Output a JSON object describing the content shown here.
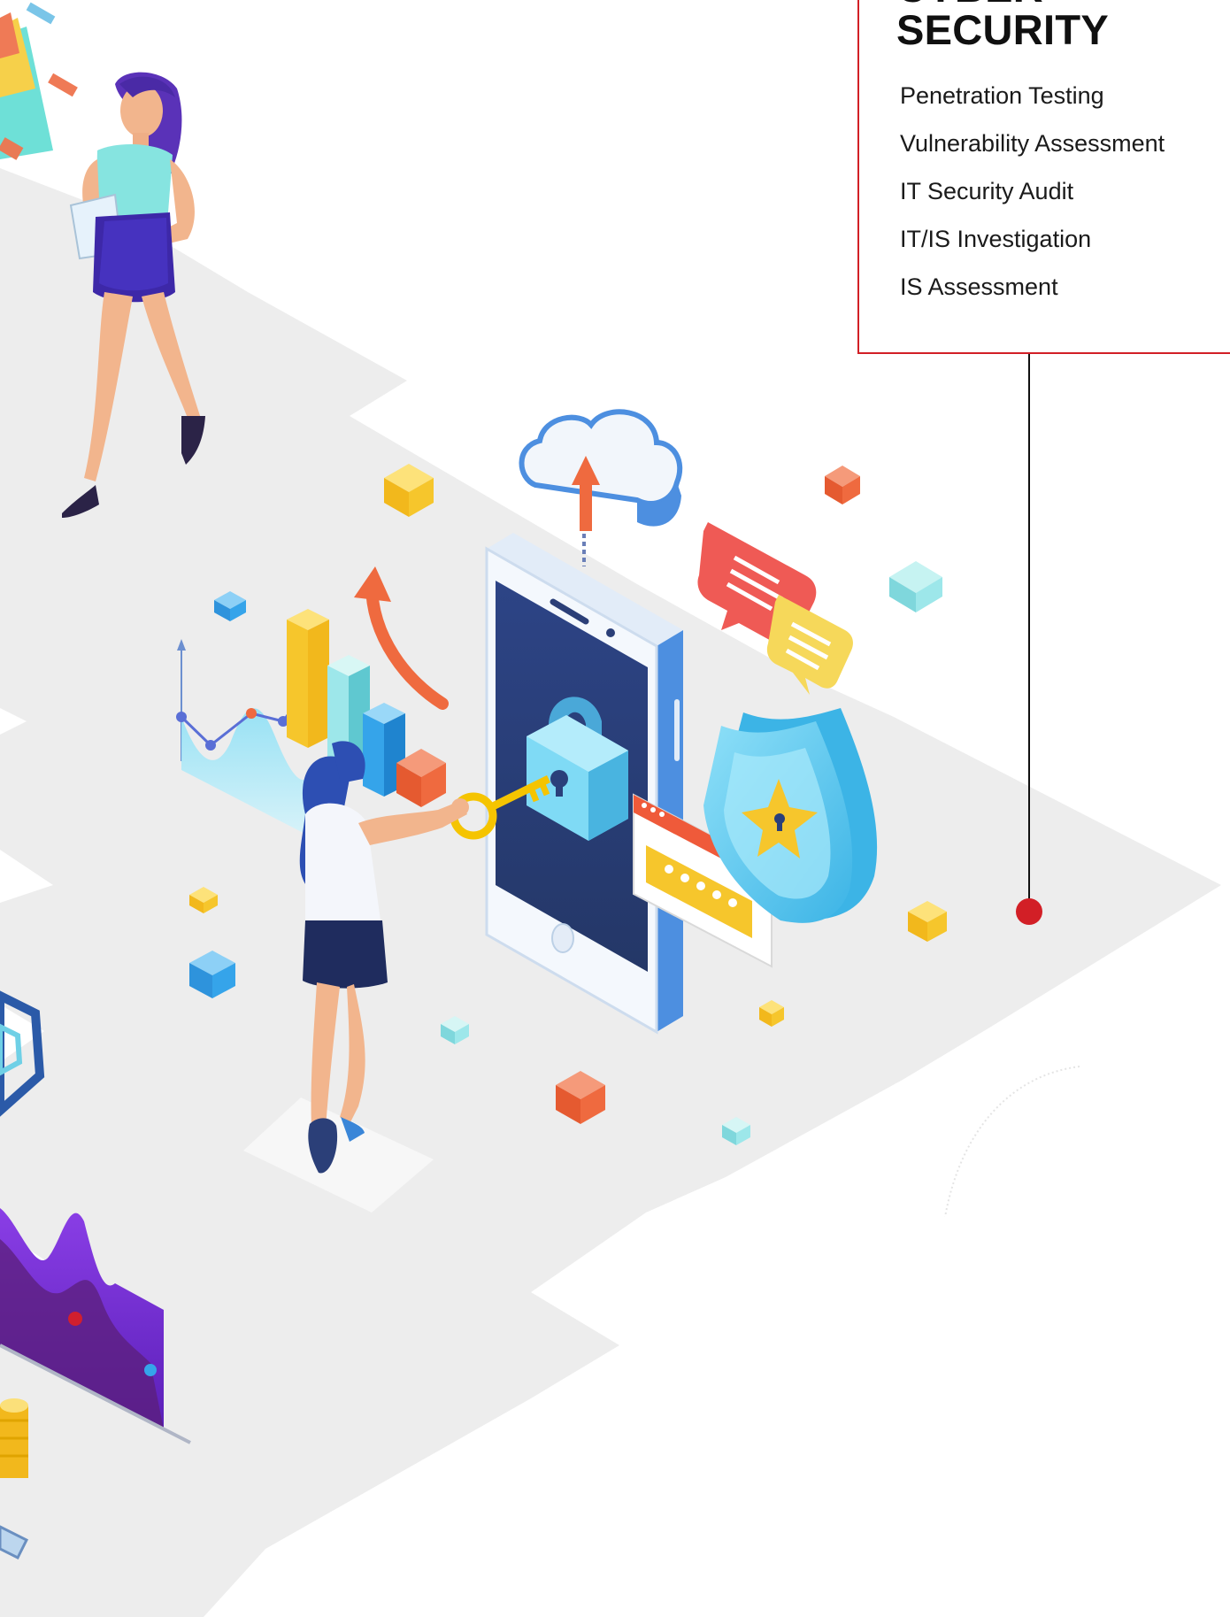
{
  "card": {
    "title_line1": "CYBER",
    "title_line2": "SECURITY",
    "services": [
      "Penetration Testing",
      "Vulnerability Assessment",
      "IT Security Audit",
      "IT/IS Investigation",
      "IS Assessment"
    ]
  },
  "colors": {
    "accent_red": "#d21f26",
    "floor": "#ededed",
    "screen_navy": "#2b3f78",
    "phone_blue": "#4d8fe0",
    "lock_cyan": "#6fd0f0",
    "key_gold": "#f5c400",
    "cube_orange": "#ef6a3f",
    "cube_yellow": "#f6c62c",
    "cube_teal": "#8fe3e6",
    "cube_blue": "#35a4ea",
    "wave_purple": "#7b2fd8"
  },
  "icons": [
    "cloud-upload-icon",
    "smartphone-icon",
    "padlock-icon",
    "key-icon",
    "password-window-icon",
    "shield-star-icon",
    "chat-bubble-icon",
    "bar-chart-icon",
    "line-chart-icon",
    "coin-stack-icon"
  ]
}
